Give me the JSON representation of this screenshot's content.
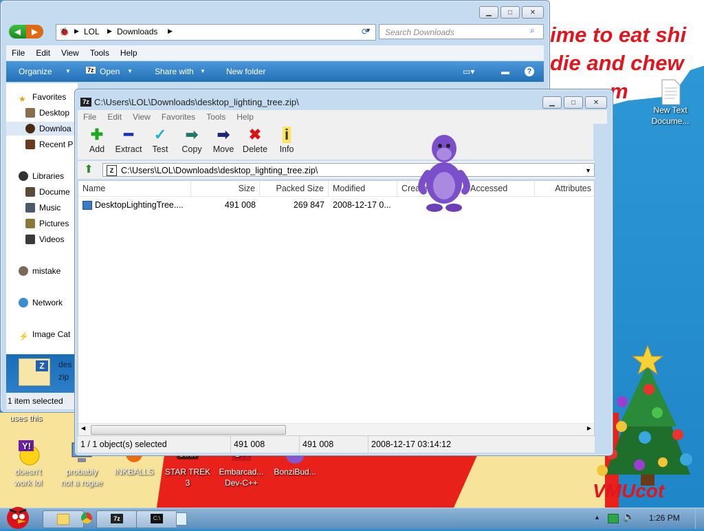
{
  "desktop": {
    "wallpaper_text": "ime to eat shi\ndie and chew\n          m",
    "uses_text": "uses this",
    "text_file_icon_label": "New Text\nDocume...",
    "vm_text": "VMUcot",
    "icons": [
      {
        "label": "doesn't\nwork lol",
        "icon": "yahoo-icon"
      },
      {
        "label": "probably\nnot a rogue",
        "icon": "computer-icon"
      },
      {
        "label": "INKBALLS",
        "icon": "inkball-icon"
      },
      {
        "label": "STAR TREK\n3",
        "icon": "star-trek-icon"
      },
      {
        "label": "Embarcad...\nDev-C++",
        "icon": "devcpp-icon"
      },
      {
        "label": "BonziBud...",
        "icon": "bonzi-icon"
      }
    ]
  },
  "explorer": {
    "breadcrumb": [
      "LOL",
      "Downloads"
    ],
    "search_placeholder": "Search Downloads",
    "menu": [
      "File",
      "Edit",
      "View",
      "Tools",
      "Help"
    ],
    "commands": {
      "organize": "Organize",
      "open": "Open",
      "share": "Share with",
      "new_folder": "New folder"
    },
    "nav": {
      "favorites": "Favorites",
      "desktop": "Desktop",
      "downloads": "Downloa",
      "recent": "Recent P",
      "libraries": "Libraries",
      "documents": "Docume",
      "music": "Music",
      "pictures": "Pictures",
      "videos": "Videos",
      "mistake": "mistake",
      "network": "Network",
      "image_catalog": "Image Cat"
    },
    "detail": {
      "name": "des",
      "ext": "zip"
    },
    "status": "1 item selected"
  },
  "zip": {
    "title": "C:\\Users\\LOL\\Downloads\\desktop_lighting_tree.zip\\",
    "menu": [
      "File",
      "Edit",
      "View",
      "Favorites",
      "Tools",
      "Help"
    ],
    "toolbar": {
      "add": "Add",
      "extract": "Extract",
      "test": "Test",
      "copy": "Copy",
      "move": "Move",
      "delete": "Delete",
      "info": "Info"
    },
    "address": "C:\\Users\\LOL\\Downloads\\desktop_lighting_tree.zip\\",
    "columns": {
      "name": "Name",
      "size": "Size",
      "packed": "Packed Size",
      "modified": "Modified",
      "created": "Created",
      "accessed": "Accessed",
      "attributes": "Attributes"
    },
    "files": [
      {
        "name": "DesktopLightingTree....",
        "size": "491 008",
        "packed": "269 847",
        "modified": "2008-12-17 0..."
      }
    ],
    "status": {
      "selected": "1 / 1 object(s) selected",
      "size": "491 008",
      "packed": "491 008",
      "date": "2008-12-17 03:14:12"
    }
  },
  "taskbar": {
    "clock": "1:26 PM"
  },
  "colors": {
    "accent": "#2470b8",
    "wallpaper_red": "#e0151e",
    "bonzi_purple": "#7b4fc9"
  }
}
